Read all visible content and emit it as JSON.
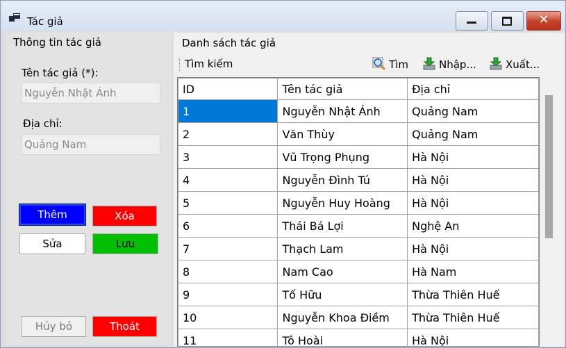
{
  "window": {
    "title": "Tác giả"
  },
  "left": {
    "group_title": "Thông tin tác giả",
    "name_label": "Tên tác giả (*):",
    "name_value": "Nguyễn Nhật Ánh",
    "address_label": "Địa chỉ:",
    "address_value": "Quảng Nam",
    "buttons": {
      "add": "Thêm",
      "delete": "Xóa",
      "edit": "Sửa",
      "save": "Lưu",
      "cancel": "Hủy bỏ",
      "exit": "Thoát"
    }
  },
  "right": {
    "group_title": "Danh sách tác giả",
    "toolbar": {
      "search_label": "Tìm kiếm",
      "find": "Tìm",
      "import": "Nhập...",
      "export": "Xuất..."
    },
    "columns": [
      "ID",
      "Tên tác giả",
      "Địa chỉ"
    ],
    "rows": [
      [
        "1",
        "Nguyễn Nhật Ánh",
        "Quảng Nam"
      ],
      [
        "2",
        "Văn Thùy",
        "Quảng Nam"
      ],
      [
        "3",
        "Vũ Trọng Phụng",
        "Hà Nội"
      ],
      [
        "4",
        "Nguyễn Đình Tú",
        "Hà Nội"
      ],
      [
        "5",
        "Nguyễn Huy Hoàng",
        "Hà Nội"
      ],
      [
        "6",
        "Thái Bá Lợi",
        "Nghệ An"
      ],
      [
        "7",
        "Thạch Lam",
        "Hà Nội"
      ],
      [
        "8",
        "Nam Cao",
        "Hà Nam"
      ],
      [
        "9",
        "Tố Hữu",
        "Thừa Thiên Huế"
      ],
      [
        "10",
        "Nguyễn Khoa Điềm",
        "Thừa Thiên Huế"
      ],
      [
        "11",
        "Tô Hoài",
        "Hà Nội"
      ]
    ]
  },
  "colors": {
    "add_button": "#0000ff",
    "delete_button": "#ff0000",
    "save_button": "#00bf00",
    "exit_button": "#ff0000",
    "selection": "#0078d7"
  },
  "icons": [
    "app-icon",
    "minimize-icon",
    "maximize-icon",
    "close-icon",
    "magnifier-icon",
    "import-icon",
    "export-icon"
  ]
}
